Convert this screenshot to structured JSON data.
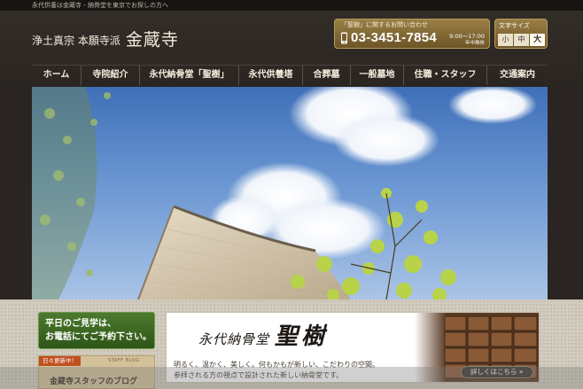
{
  "topbar": {
    "tagline": "永代供養は金蔵寺 - 納骨堂を東京でお探しの方へ"
  },
  "header": {
    "school": "浄土真宗 本願寺派",
    "temple_name": "金蔵寺"
  },
  "contact": {
    "label": "「聖樹」に関するお問い合わせ",
    "phone": "03-3451-7854",
    "hours": "9:00～17:00",
    "closed": "年中無休",
    "icon": "phone-icon"
  },
  "font_size": {
    "label": "文字サイズ",
    "options": [
      "小",
      "中",
      "大"
    ],
    "selected": "大"
  },
  "nav": {
    "items": [
      {
        "label": "ホーム"
      },
      {
        "label": "寺院紹介"
      },
      {
        "label": "永代納骨堂「聖樹」"
      },
      {
        "label": "永代供養塔"
      },
      {
        "label": "合葬墓"
      },
      {
        "label": "一般墓地"
      },
      {
        "label": "住職・スタッフ"
      },
      {
        "label": "交通案内"
      }
    ]
  },
  "sidebar": {
    "visit": {
      "line1": "平日のご見学は、",
      "line2": "お電話にてご予約下さい。"
    },
    "blog": {
      "tag": "日々更新中！",
      "staff": "STAFF BLOG",
      "title": "金蔵寺スタッフのブログ"
    }
  },
  "promo": {
    "brand_small": "永代納骨堂",
    "brand_big": "聖樹",
    "desc_line1": "明るく、温かく、美しく。何もかもが新しい、こだわりの空間。",
    "desc_line2": "参拝される方の視点で設計された新しい納骨堂です。",
    "more": "詳しくはこちら"
  },
  "colors": {
    "brand_brown": "#2a2522",
    "gold": "#8a6f3a",
    "green": "#3d6a22",
    "blog_tag": "#c0501f"
  }
}
